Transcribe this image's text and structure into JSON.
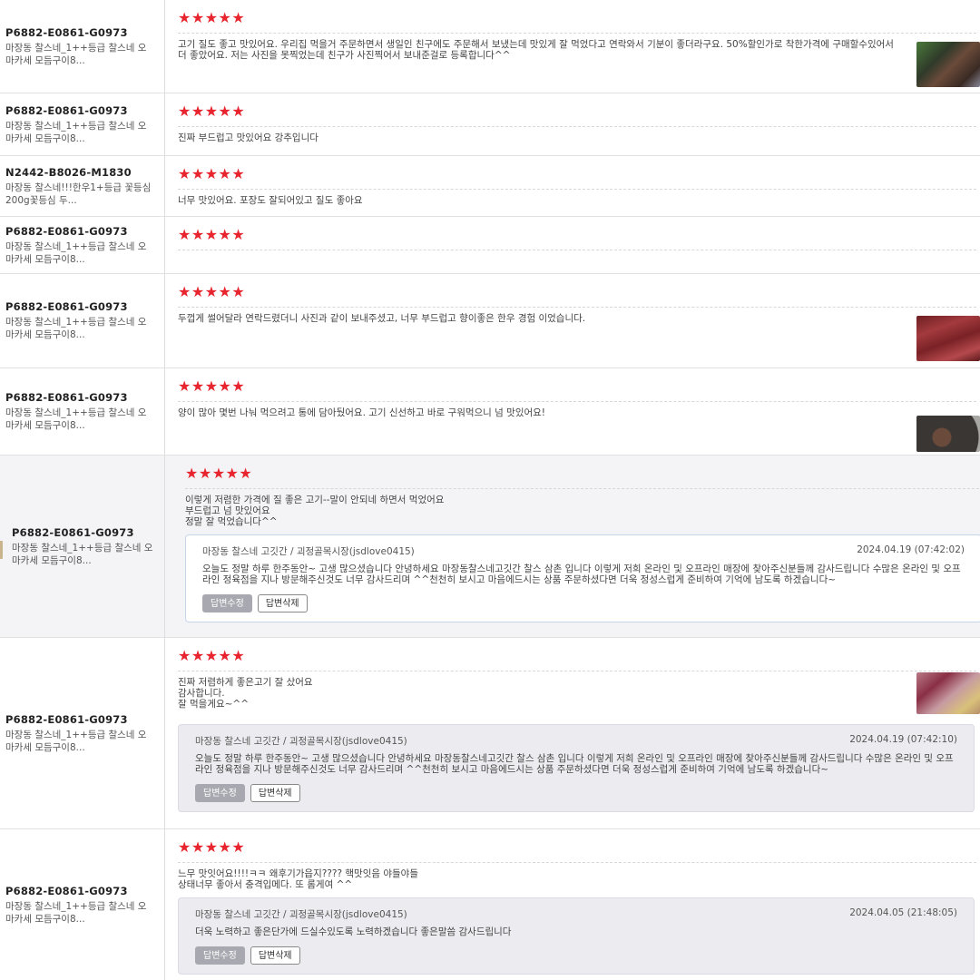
{
  "reviews": [
    {
      "product_code": "P6882-E0861-G0973",
      "product_name": "마장동 찰스네_1++등급 찰스네 오마카세 모듬구이8...",
      "stars": "★★★★★",
      "text": "고기 질도 좋고 맛있어요. 우리집 먹을거 주문하면서 생일인 친구에도 주문해서 보냈는데 맛있게 잘 먹었다고 연락와서 기분이 좋더라구요. 50%할인가로 착한가격에 구매할수있어서 더 좋았어요. 저는 사진을 못찍었는데 친구가 사진찍어서 보내준걸로 등록합니다^^",
      "photo": "review-photo"
    },
    {
      "product_code": "P6882-E0861-G0973",
      "product_name": "마장동 찰스네_1++등급 찰스네 오마카세 모듬구이8...",
      "stars": "★★★★★",
      "text": "진짜 부드럽고 맛있어요 강추입니다"
    },
    {
      "product_code": "N2442-B8026-M1830",
      "product_name": "마장동 찰스네!!!한우1+등급 꽃등심200g꽃등심 두...",
      "stars": "★★★★★",
      "text": "너무 맛있어요. 포장도 잘되어있고 질도 좋아요"
    },
    {
      "product_code": "P6882-E0861-G0973",
      "product_name": "마장동 찰스네_1++등급 찰스네 오마카세 모듬구이8...",
      "stars": "★★★★★",
      "text": ""
    },
    {
      "product_code": "P6882-E0861-G0973",
      "product_name": "마장동 찰스네_1++등급 찰스네 오마카세 모듬구이8...",
      "stars": "★★★★★",
      "text": "두껍게 썰어달라 연락드렸더니 사진과 같이 보내주셨고, 너무 부드럽고 향이좋은 한우 경험 이었습니다.",
      "photo": "review-photo"
    },
    {
      "product_code": "P6882-E0861-G0973",
      "product_name": "마장동 찰스네_1++등급 찰스네 오마카세 모듬구이8...",
      "stars": "★★★★★",
      "text": "양이 많아 몇번 나눠 먹으려고 통에 담아뒀어요. 고기 신선하고 바로 구워먹으니 넘 맛있어요!",
      "photo": "review-photo"
    },
    {
      "product_code": "P6882-E0861-G0973",
      "product_name": "마장동 찰스네_1++등급 찰스네 오마카세 모듬구이8...",
      "stars": "★★★★★",
      "text": "이렇게 저렴한 가격에 질 좋은 고기--말이 안되네 하면서 먹었어요\n부드럽고 넘 맛있어요\n정말 잘 먹었습니다^^",
      "reply": {
        "author": "마장동 찰스네 고깃간 / 괴정골목시장(jsdlove0415)",
        "date": "2024.04.19 (07:42:02)",
        "text": "오늘도 정말 하루 한주동안~ 고생 많으셨습니다 안녕하세요 마장동찰스네고깃간 찰스 삼촌 입니다 이렇게 저희 온라인 및 오프라인 매장에 찾아주신분들께 감사드립니다 수많은 온라인 및 오프라인 정육점을 지나 방문해주신것도 너무 감사드리며 ^^천천히 보시고 마음에드시는 상품 주문하셨다면 더욱 정성스럽게 준비하여 기억에 남도록 하겠습니다~",
        "edit_label": "답변수정",
        "delete_label": "답변삭제"
      }
    },
    {
      "product_code": "P6882-E0861-G0973",
      "product_name": "마장동 찰스네_1++등급 찰스네 오마카세 모듬구이8...",
      "stars": "★★★★★",
      "text": "진짜 저렴하게 좋은고기 잘 샀어요\n감사합니다.\n잘 먹을게요~^^",
      "photo": "review-photo",
      "reply": {
        "author": "마장동 찰스네 고깃간 / 괴정골목시장(jsdlove0415)",
        "date": "2024.04.19 (07:42:10)",
        "text": "오늘도 정말 하루 한주동안~ 고생 많으셨습니다 안녕하세요 마장동찰스네고깃간 찰스 삼촌 입니다 이렇게 저희 온라인 및 오프라인 매장에 찾아주신분들께 감사드립니다 수많은 온라인 및 오프라인 정육점을 지나 방문해주신것도 너무 감사드리며 ^^천천히 보시고 마음에드시는 상품 주문하셨다면 더욱 정성스럽게 준비하여 기억에 남도록 하겠습니다~",
        "edit_label": "답변수정",
        "delete_label": "답변삭제"
      }
    },
    {
      "product_code": "P6882-E0861-G0973",
      "product_name": "마장동 찰스네_1++등급 찰스네 오마카세 모듬구이8...",
      "stars": "★★★★★",
      "text": "느무 맛잇어요!!!!ㅋㅋ 왜후기가읍지???? 핵맛잇음 야들야들\n상태너무 좋아서 충격입메다. 또 롬게여 ^^",
      "reply": {
        "author": "마장동 찰스네 고깃간 / 괴정골목시장(jsdlove0415)",
        "date": "2024.04.05 (21:48:05)",
        "text": "더욱 노력하고 좋은단가에 드실수있도록 노력하겠습니다 좋은말씀 감사드립니다",
        "edit_label": "답변수정",
        "delete_label": "답변삭제"
      }
    }
  ]
}
